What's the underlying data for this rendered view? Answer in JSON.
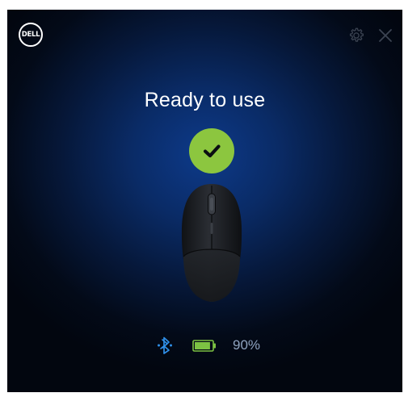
{
  "brand": {
    "logo_text": "DELL"
  },
  "window": {
    "title": "Ready to use",
    "status_icon": "check-icon",
    "status_color": "#8cc63f"
  },
  "toolbar": {
    "settings_icon": "gear-icon",
    "close_icon": "close-icon"
  },
  "device": {
    "type": "mouse",
    "color": "#1b1d21"
  },
  "status_bar": {
    "connection_icon": "bluetooth-icon",
    "connection_color": "#2f8fe8",
    "battery_icon": "battery-icon",
    "battery_color": "#7cc243",
    "battery_level": 0.9,
    "battery_label": "90%"
  }
}
